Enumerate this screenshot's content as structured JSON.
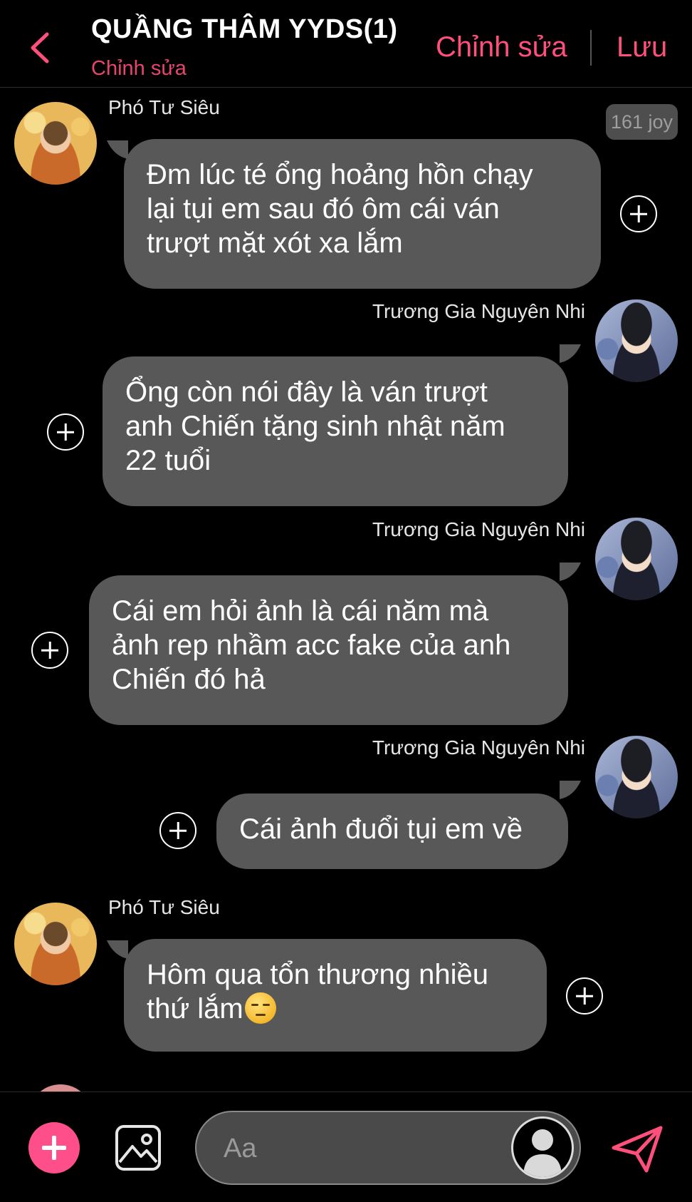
{
  "header": {
    "title": "QUẦNG THÂM YYDS(1)",
    "subtitle": "Chỉnh sửa",
    "edit_label": "Chỉnh sửa",
    "save_label": "Lưu",
    "back_icon": "chevron-left-icon",
    "accent_color": "#ff4f7b"
  },
  "badge": {
    "joy": "161 joy"
  },
  "messages": [
    {
      "sender": "Phó Tư Siêu",
      "side": "left",
      "avatar": "avatar-pho",
      "text": "Đm lúc té ổng hoảng hồn chạy\nlại tụi em sau đó ôm cái ván\ntrượt mặt xót xa lắm"
    },
    {
      "sender": "Trương Gia Nguyên Nhi",
      "side": "right",
      "avatar": "avatar-nhi",
      "text": "Ổng còn nói đây là ván trượt\nanh Chiến tặng sinh nhật năm\n22 tuổi"
    },
    {
      "sender": "Trương Gia Nguyên Nhi",
      "side": "right",
      "avatar": "avatar-nhi",
      "text": "Cái em hỏi ảnh là cái năm mà\nảnh rep nhầm acc fake của anh\nChiến đó hả"
    },
    {
      "sender": "Trương Gia Nguyên Nhi",
      "side": "right",
      "avatar": "avatar-nhi",
      "text": "Cái ảnh đuổi tụi em về"
    },
    {
      "sender": "Phó Tư Siêu",
      "side": "left",
      "avatar": "avatar-pho",
      "text": "Hôm qua tổn thương nhiều\nthứ lắm",
      "emoji": "pensive-face-icon"
    }
  ],
  "composer": {
    "placeholder": "Aa",
    "add_icon": "plus-icon",
    "image_icon": "image-icon",
    "send_icon": "send-icon"
  },
  "colors": {
    "bubble": "#585858",
    "background": "#000000",
    "add_button": "#ff4f8a"
  }
}
